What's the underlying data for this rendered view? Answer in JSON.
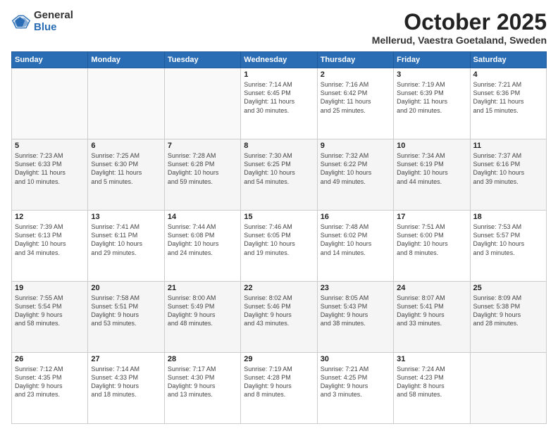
{
  "logo": {
    "general": "General",
    "blue": "Blue"
  },
  "header": {
    "month": "October 2025",
    "location": "Mellerud, Vaestra Goetaland, Sweden"
  },
  "days_of_week": [
    "Sunday",
    "Monday",
    "Tuesday",
    "Wednesday",
    "Thursday",
    "Friday",
    "Saturday"
  ],
  "weeks": [
    [
      {
        "day": "",
        "info": ""
      },
      {
        "day": "",
        "info": ""
      },
      {
        "day": "",
        "info": ""
      },
      {
        "day": "1",
        "info": "Sunrise: 7:14 AM\nSunset: 6:45 PM\nDaylight: 11 hours\nand 30 minutes."
      },
      {
        "day": "2",
        "info": "Sunrise: 7:16 AM\nSunset: 6:42 PM\nDaylight: 11 hours\nand 25 minutes."
      },
      {
        "day": "3",
        "info": "Sunrise: 7:19 AM\nSunset: 6:39 PM\nDaylight: 11 hours\nand 20 minutes."
      },
      {
        "day": "4",
        "info": "Sunrise: 7:21 AM\nSunset: 6:36 PM\nDaylight: 11 hours\nand 15 minutes."
      }
    ],
    [
      {
        "day": "5",
        "info": "Sunrise: 7:23 AM\nSunset: 6:33 PM\nDaylight: 11 hours\nand 10 minutes."
      },
      {
        "day": "6",
        "info": "Sunrise: 7:25 AM\nSunset: 6:30 PM\nDaylight: 11 hours\nand 5 minutes."
      },
      {
        "day": "7",
        "info": "Sunrise: 7:28 AM\nSunset: 6:28 PM\nDaylight: 10 hours\nand 59 minutes."
      },
      {
        "day": "8",
        "info": "Sunrise: 7:30 AM\nSunset: 6:25 PM\nDaylight: 10 hours\nand 54 minutes."
      },
      {
        "day": "9",
        "info": "Sunrise: 7:32 AM\nSunset: 6:22 PM\nDaylight: 10 hours\nand 49 minutes."
      },
      {
        "day": "10",
        "info": "Sunrise: 7:34 AM\nSunset: 6:19 PM\nDaylight: 10 hours\nand 44 minutes."
      },
      {
        "day": "11",
        "info": "Sunrise: 7:37 AM\nSunset: 6:16 PM\nDaylight: 10 hours\nand 39 minutes."
      }
    ],
    [
      {
        "day": "12",
        "info": "Sunrise: 7:39 AM\nSunset: 6:13 PM\nDaylight: 10 hours\nand 34 minutes."
      },
      {
        "day": "13",
        "info": "Sunrise: 7:41 AM\nSunset: 6:11 PM\nDaylight: 10 hours\nand 29 minutes."
      },
      {
        "day": "14",
        "info": "Sunrise: 7:44 AM\nSunset: 6:08 PM\nDaylight: 10 hours\nand 24 minutes."
      },
      {
        "day": "15",
        "info": "Sunrise: 7:46 AM\nSunset: 6:05 PM\nDaylight: 10 hours\nand 19 minutes."
      },
      {
        "day": "16",
        "info": "Sunrise: 7:48 AM\nSunset: 6:02 PM\nDaylight: 10 hours\nand 14 minutes."
      },
      {
        "day": "17",
        "info": "Sunrise: 7:51 AM\nSunset: 6:00 PM\nDaylight: 10 hours\nand 8 minutes."
      },
      {
        "day": "18",
        "info": "Sunrise: 7:53 AM\nSunset: 5:57 PM\nDaylight: 10 hours\nand 3 minutes."
      }
    ],
    [
      {
        "day": "19",
        "info": "Sunrise: 7:55 AM\nSunset: 5:54 PM\nDaylight: 9 hours\nand 58 minutes."
      },
      {
        "day": "20",
        "info": "Sunrise: 7:58 AM\nSunset: 5:51 PM\nDaylight: 9 hours\nand 53 minutes."
      },
      {
        "day": "21",
        "info": "Sunrise: 8:00 AM\nSunset: 5:49 PM\nDaylight: 9 hours\nand 48 minutes."
      },
      {
        "day": "22",
        "info": "Sunrise: 8:02 AM\nSunset: 5:46 PM\nDaylight: 9 hours\nand 43 minutes."
      },
      {
        "day": "23",
        "info": "Sunrise: 8:05 AM\nSunset: 5:43 PM\nDaylight: 9 hours\nand 38 minutes."
      },
      {
        "day": "24",
        "info": "Sunrise: 8:07 AM\nSunset: 5:41 PM\nDaylight: 9 hours\nand 33 minutes."
      },
      {
        "day": "25",
        "info": "Sunrise: 8:09 AM\nSunset: 5:38 PM\nDaylight: 9 hours\nand 28 minutes."
      }
    ],
    [
      {
        "day": "26",
        "info": "Sunrise: 7:12 AM\nSunset: 4:35 PM\nDaylight: 9 hours\nand 23 minutes."
      },
      {
        "day": "27",
        "info": "Sunrise: 7:14 AM\nSunset: 4:33 PM\nDaylight: 9 hours\nand 18 minutes."
      },
      {
        "day": "28",
        "info": "Sunrise: 7:17 AM\nSunset: 4:30 PM\nDaylight: 9 hours\nand 13 minutes."
      },
      {
        "day": "29",
        "info": "Sunrise: 7:19 AM\nSunset: 4:28 PM\nDaylight: 9 hours\nand 8 minutes."
      },
      {
        "day": "30",
        "info": "Sunrise: 7:21 AM\nSunset: 4:25 PM\nDaylight: 9 hours\nand 3 minutes."
      },
      {
        "day": "31",
        "info": "Sunrise: 7:24 AM\nSunset: 4:23 PM\nDaylight: 8 hours\nand 58 minutes."
      },
      {
        "day": "",
        "info": ""
      }
    ]
  ]
}
